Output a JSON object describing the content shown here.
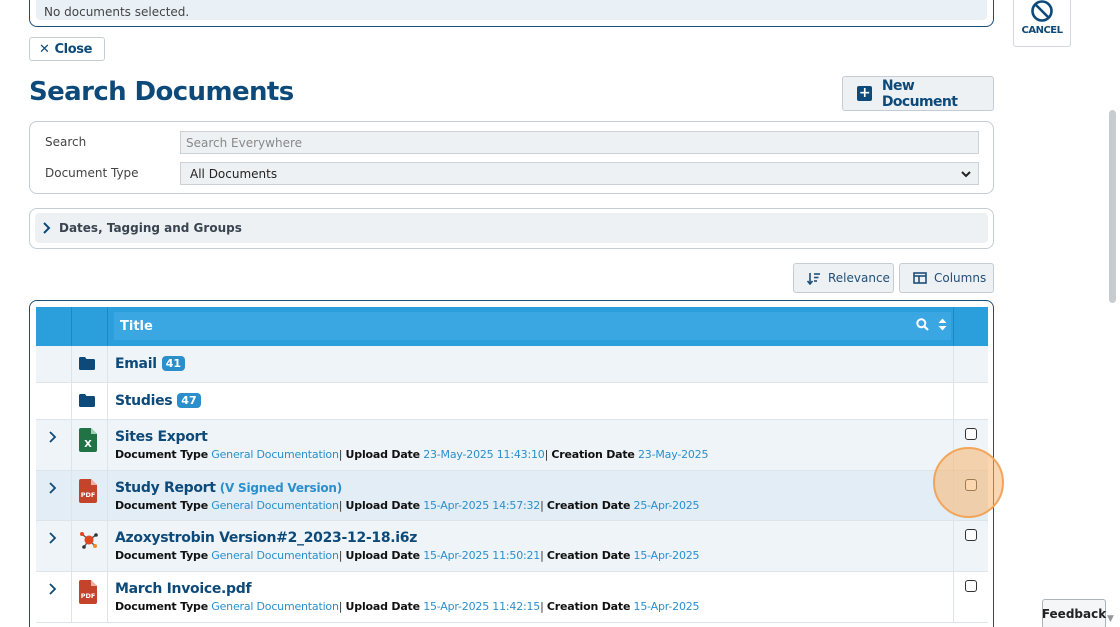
{
  "selection": {
    "status_text": "No documents selected."
  },
  "actions": {
    "close_label": "Close",
    "cancel_label": "CANCEL",
    "new_document_label": "New Document"
  },
  "page": {
    "title": "Search Documents"
  },
  "search": {
    "search_label": "Search",
    "search_placeholder": "Search Everywhere",
    "doctype_label": "Document Type",
    "doctype_selected": "All Documents"
  },
  "filters": {
    "dates_section_label": "Dates, Tagging and Groups"
  },
  "toolbar": {
    "sort_label": "Relevance",
    "columns_label": "Columns"
  },
  "table": {
    "header_title": "Title",
    "folders": [
      {
        "name": "Email",
        "count": "41"
      },
      {
        "name": "Studies",
        "count": "47"
      }
    ],
    "meta_labels": {
      "doctype": "Document Type",
      "upload": "Upload Date",
      "creation": "Creation Date",
      "sep": "|"
    },
    "documents": [
      {
        "title": "Sites Export",
        "version": "",
        "icon": "excel-icon",
        "doctype": "General Documentation",
        "upload_date": "23-May-2025 11:43:10",
        "creation_date": "23-May-2025"
      },
      {
        "title": "Study Report",
        "version": "(V Signed Version)",
        "icon": "pdf-icon",
        "doctype": "General Documentation",
        "upload_date": "15-Apr-2025 14:57:32",
        "creation_date": "25-Apr-2025"
      },
      {
        "title": "Azoxystrobin Version#2_2023-12-18.i6z",
        "version": "",
        "icon": "molecule-icon",
        "doctype": "General Documentation",
        "upload_date": "15-Apr-2025 11:50:21",
        "creation_date": "15-Apr-2025"
      },
      {
        "title": "March Invoice.pdf",
        "version": "",
        "icon": "pdf-icon",
        "doctype": "General Documentation",
        "upload_date": "15-Apr-2025 11:42:15",
        "creation_date": "15-Apr-2025"
      }
    ]
  },
  "feedback": {
    "label": "Feedback"
  },
  "colors": {
    "brand": "#0d4a7a",
    "header": "#2b9fdc",
    "link": "#2b8fcc",
    "highlight": "#f2a55a"
  }
}
